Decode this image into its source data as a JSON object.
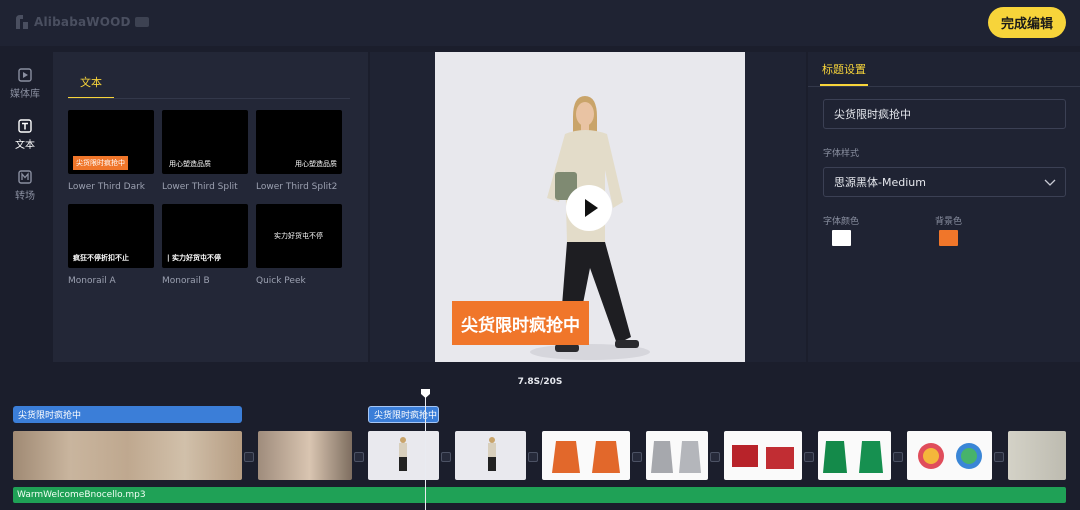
{
  "app": {
    "logo_text": "AlibabaWOOD",
    "done_label": "完成编辑"
  },
  "nav": [
    {
      "label": "媒体库",
      "icon": "media-library-icon"
    },
    {
      "label": "文本",
      "icon": "text-icon"
    },
    {
      "label": "转场",
      "icon": "transition-icon"
    }
  ],
  "text_panel": {
    "tab": "文本",
    "templates": [
      {
        "name": "Lower Third Dark",
        "sample": "尖货限时疯抢中"
      },
      {
        "name": "Lower Third Split",
        "sample": "用心塑造品质"
      },
      {
        "name": "Lower Third Split2",
        "sample": "用心塑造品质"
      },
      {
        "name": "Monorail A",
        "sample": "疯狂不停折扣不止"
      },
      {
        "name": "Monorail B",
        "sample": "| 实力好货屯不停"
      },
      {
        "name": "Quick Peek",
        "sample": "实力好货屯不停"
      }
    ]
  },
  "preview": {
    "caption": "尖货限时疯抢中"
  },
  "settings": {
    "tab": "标题设置",
    "title_value": "尖货限时疯抢中",
    "font_style_label": "字体样式",
    "font_value": "思源黑体-Medium",
    "font_color_label": "字体颜色",
    "bg_color_label": "背景色",
    "font_color": "#ffffff",
    "bg_color": "#f0762a"
  },
  "timeline": {
    "time_readout": "7.8S/20S",
    "caption_clips": [
      {
        "label": "尖货限时疯抢中",
        "selected": false
      },
      {
        "label": "尖货限时疯抢中",
        "selected": true
      }
    ],
    "audio_label": "WarmWelcomeBnocello.mp3"
  },
  "colors": {
    "accent": "#f7d43a",
    "caption_bg": "#f0762a",
    "clip_blue": "#3b7ed8",
    "audio_green": "#1fa156"
  }
}
